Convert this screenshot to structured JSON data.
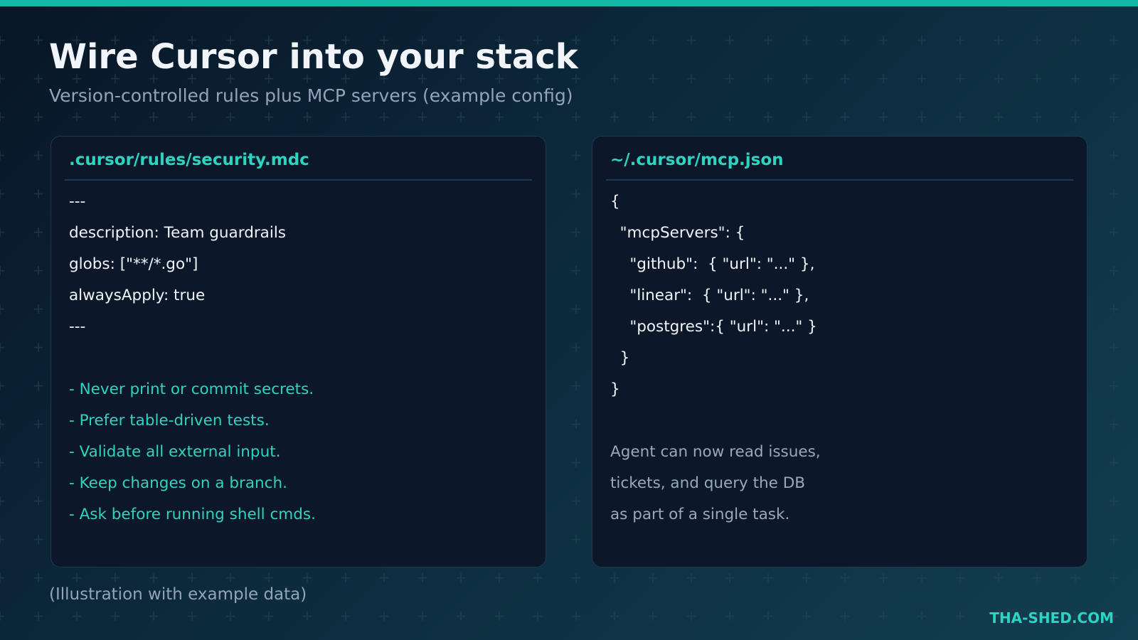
{
  "header": {
    "title": "Wire Cursor into your stack",
    "subtitle": "Version-controlled rules plus MCP servers (example config)"
  },
  "panels": [
    {
      "title": ".cursor/rules/security.mdc",
      "lines": [
        {
          "text": "---",
          "style": "normal"
        },
        {
          "text": "description: Team guardrails",
          "style": "normal"
        },
        {
          "text": "globs: [\"**/*.go\"]",
          "style": "normal"
        },
        {
          "text": "alwaysApply: true",
          "style": "normal"
        },
        {
          "text": "---",
          "style": "normal"
        },
        {
          "text": "",
          "style": "normal"
        },
        {
          "text": "- Never print or commit secrets.",
          "style": "accent"
        },
        {
          "text": "- Prefer table-driven tests.",
          "style": "accent"
        },
        {
          "text": "- Validate all external input.",
          "style": "accent"
        },
        {
          "text": "- Keep changes on a branch.",
          "style": "accent"
        },
        {
          "text": "- Ask before running shell cmds.",
          "style": "accent"
        }
      ]
    },
    {
      "title": "~/.cursor/mcp.json",
      "lines": [
        {
          "text": "{",
          "style": "normal"
        },
        {
          "text": "  \"mcpServers\": {",
          "style": "normal"
        },
        {
          "text": "    \"github\":  { \"url\": \"...\" },",
          "style": "normal"
        },
        {
          "text": "    \"linear\":  { \"url\": \"...\" },",
          "style": "normal"
        },
        {
          "text": "    \"postgres\":{ \"url\": \"...\" }",
          "style": "normal"
        },
        {
          "text": "  }",
          "style": "normal"
        },
        {
          "text": "}",
          "style": "normal"
        },
        {
          "text": "",
          "style": "normal"
        },
        {
          "text": "Agent can now read issues,",
          "style": "muted"
        },
        {
          "text": "tickets, and query the DB",
          "style": "muted"
        },
        {
          "text": "as part of a single task.",
          "style": "muted"
        }
      ]
    }
  ],
  "footer": {
    "note": "(Illustration with example data)",
    "brand": "THA-SHED.COM"
  },
  "colors": {
    "accent": "#2dd4bf",
    "top_bar": "#14b8a6",
    "panel_bg": "#0c1829",
    "muted_text": "#94a3b8"
  }
}
